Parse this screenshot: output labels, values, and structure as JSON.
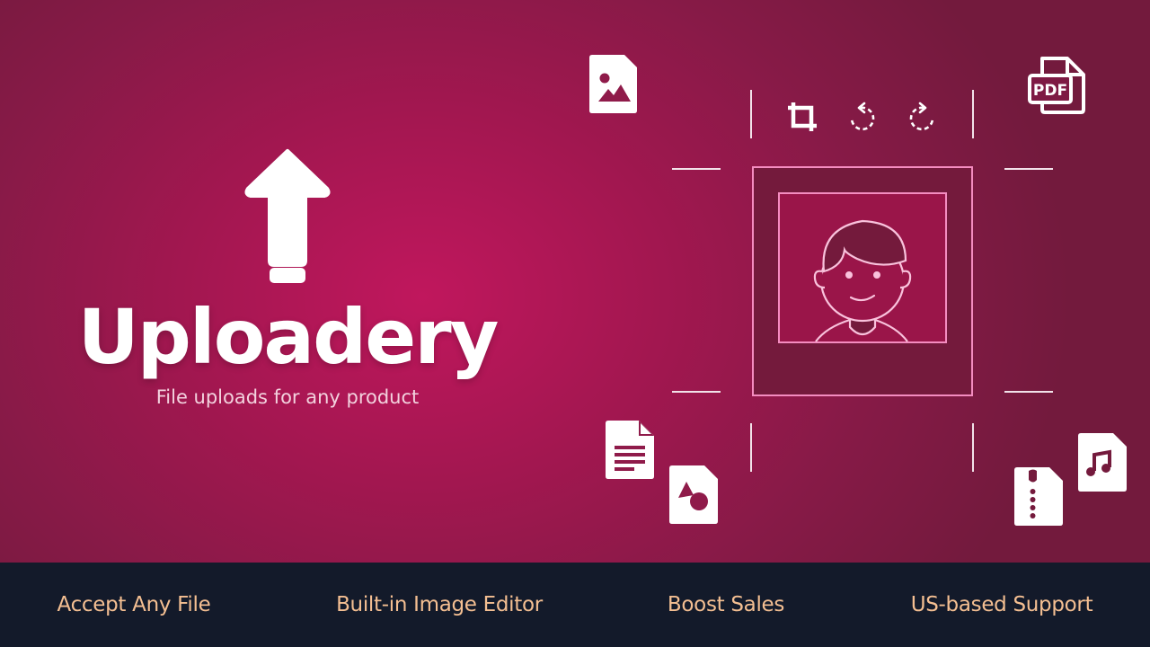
{
  "brand": {
    "title": "Uploadery",
    "tagline": "File uploads for any product"
  },
  "editor_toolbar": {
    "tools": [
      {
        "name": "crop",
        "icon": "crop-icon"
      },
      {
        "name": "rotate-left",
        "icon": "rotate-left-icon"
      },
      {
        "name": "rotate-right",
        "icon": "rotate-right-icon"
      }
    ]
  },
  "file_types": [
    {
      "name": "image",
      "icon": "image-file-icon"
    },
    {
      "name": "pdf",
      "icon": "pdf-file-icon",
      "label": "PDF"
    },
    {
      "name": "document",
      "icon": "document-file-icon"
    },
    {
      "name": "shapes",
      "icon": "shapes-file-icon"
    },
    {
      "name": "zip",
      "icon": "zip-file-icon"
    },
    {
      "name": "audio",
      "icon": "audio-file-icon"
    }
  ],
  "features": [
    {
      "label": "Accept Any File"
    },
    {
      "label": "Built-in Image Editor"
    },
    {
      "label": "Boost Sales"
    },
    {
      "label": "US-based Support"
    }
  ],
  "colors": {
    "hero_center": "#c0175d",
    "hero_edge": "#731a3d",
    "footer_bg": "#131a2a",
    "feature_text": "#f4bf92",
    "frame_pink": "#f48cc0",
    "frame_dark": "#741a3c"
  }
}
